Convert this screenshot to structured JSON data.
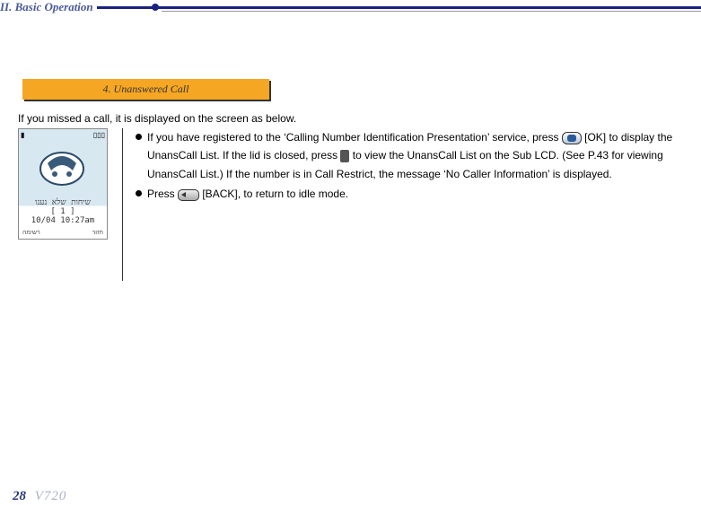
{
  "header": {
    "title": "II. Basic Operation"
  },
  "subsection": {
    "title": "4. Unanswered Call"
  },
  "intro": "If you missed a call, it is displayed on the screen as below.",
  "phone": {
    "line1": "שיחות שלא נענו",
    "line2": "[  1  ]",
    "line3": "10/04  10:27am",
    "bottom_left": "רשימה",
    "bottom_right": "חזור"
  },
  "bullets": [
    {
      "parts": [
        "If you have registered to the ‘Calling Number Identification Presentation’ service, press ",
        {
          "icon": "ok"
        },
        " [OK] to display the UnansCall List. If the lid is closed, press ",
        {
          "icon": "side"
        },
        " to view the UnansCall List on the Sub LCD. (See P.43 for viewing UnansCall List.) If the number is in Call Restrict, the message ‘No Caller Information’ is displayed."
      ]
    },
    {
      "parts": [
        "Press  ",
        {
          "icon": "back"
        },
        " [BACK], to return to idle mode."
      ]
    }
  ],
  "footer": {
    "page": "28",
    "model": "V720"
  }
}
